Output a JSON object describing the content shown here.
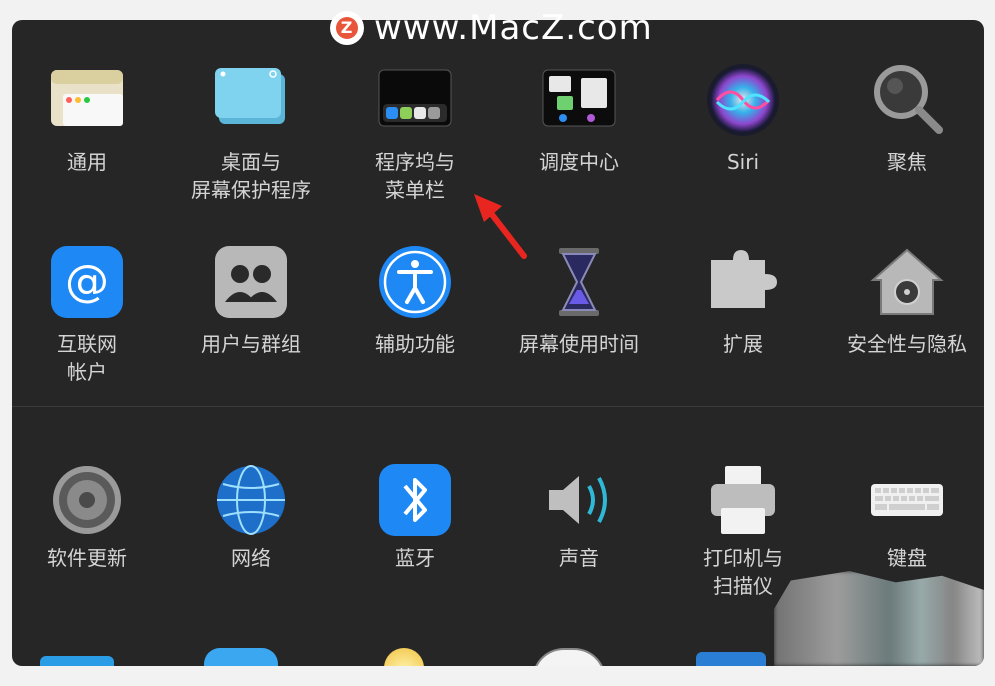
{
  "watermark": {
    "text": "www.MacZ.com",
    "logo": "Z"
  },
  "row1": [
    {
      "name": "general",
      "label": "通用",
      "icon": "general-window-icon"
    },
    {
      "name": "desktop-screensaver",
      "label": "桌面与\n屏幕保护程序",
      "icon": "desktop-folder-icon"
    },
    {
      "name": "dock-menubar",
      "label": "程序坞与\n菜单栏",
      "icon": "dock-icon"
    },
    {
      "name": "mission-control",
      "label": "调度中心",
      "icon": "mission-control-icon"
    },
    {
      "name": "siri",
      "label": "Siri",
      "icon": "siri-icon"
    },
    {
      "name": "spotlight",
      "label": "聚焦",
      "icon": "magnifier-icon"
    }
  ],
  "row2": [
    {
      "name": "internet-accounts",
      "label": "互联网\n帐户",
      "icon": "at-sign-icon"
    },
    {
      "name": "users-groups",
      "label": "用户与群组",
      "icon": "users-icon"
    },
    {
      "name": "accessibility",
      "label": "辅助功能",
      "icon": "accessibility-icon"
    },
    {
      "name": "screen-time",
      "label": "屏幕使用时间",
      "icon": "hourglass-icon"
    },
    {
      "name": "extensions",
      "label": "扩展",
      "icon": "puzzle-icon"
    },
    {
      "name": "security-privacy",
      "label": "安全性与隐私",
      "icon": "house-lock-icon"
    }
  ],
  "row3": [
    {
      "name": "software-update",
      "label": "软件更新",
      "icon": "gear-icon"
    },
    {
      "name": "network",
      "label": "网络",
      "icon": "globe-icon"
    },
    {
      "name": "bluetooth",
      "label": "蓝牙",
      "icon": "bluetooth-icon"
    },
    {
      "name": "sound",
      "label": "声音",
      "icon": "speaker-icon"
    },
    {
      "name": "printers-scanners",
      "label": "打印机与\n扫描仪",
      "icon": "printer-icon"
    },
    {
      "name": "keyboard",
      "label": "键盘",
      "icon": "keyboard-icon"
    }
  ],
  "colors": {
    "panel": "#262626",
    "label": "#d4d4d4",
    "accent_blue": "#1e88f5",
    "arrow": "#e8261f"
  }
}
